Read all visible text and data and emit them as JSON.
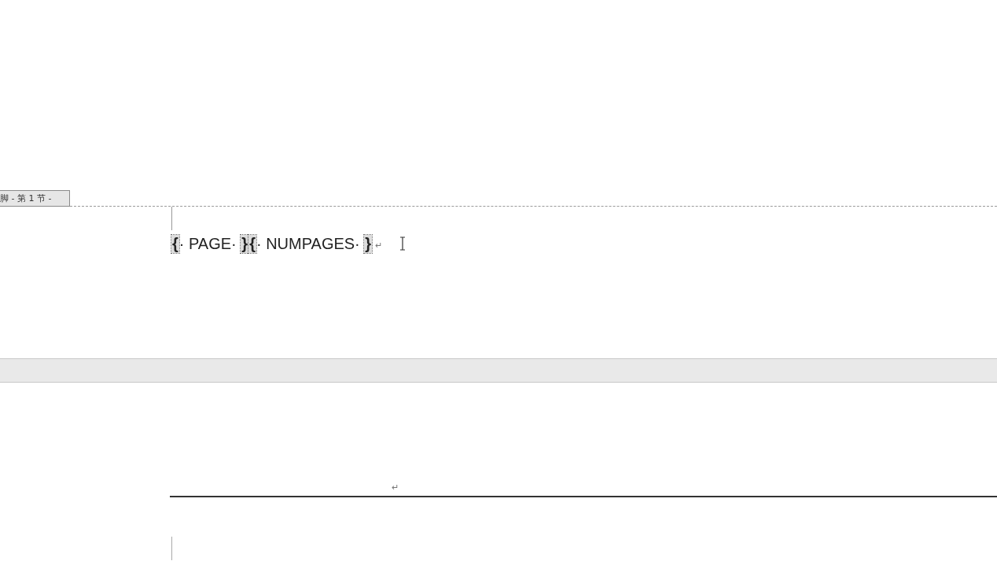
{
  "footer_tag": {
    "label": "脚 - 第 1 节 -"
  },
  "footer_line": {
    "fields": [
      {
        "open": "{",
        "code": "· PAGE· ",
        "close": "}"
      },
      {
        "open": "{",
        "code": "· NUMPAGES· ",
        "close": "}"
      }
    ],
    "paragraph_mark": "↵"
  },
  "next_page": {
    "header_paragraph_mark": "↵"
  }
}
